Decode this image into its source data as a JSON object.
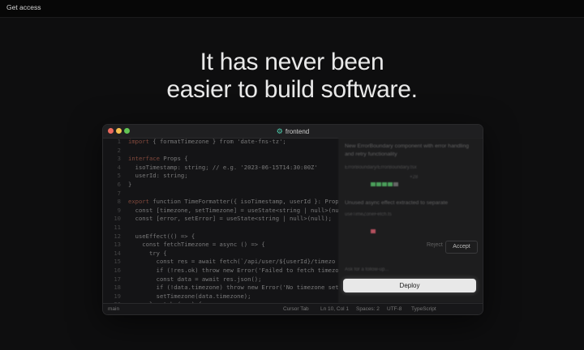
{
  "topbar": {
    "get_access": "Get access"
  },
  "hero": {
    "line1": "It has never been",
    "line2": "easier to build software."
  },
  "window": {
    "title": "frontend",
    "title_icon": "gear-icon"
  },
  "code_lines": [
    {
      "n": "1",
      "kw": "import",
      "text": " { formatTimezone } from 'date-fns-tz';"
    },
    {
      "n": "2",
      "kw": "",
      "text": ""
    },
    {
      "n": "3",
      "kw": "interface",
      "text": " Props {"
    },
    {
      "n": "4",
      "kw": "",
      "text": "  isoTimestamp: string; // e.g. '2023-06-15T14:30:00Z'"
    },
    {
      "n": "5",
      "kw": "",
      "text": "  userId: string;"
    },
    {
      "n": "6",
      "kw": "",
      "text": "}"
    },
    {
      "n": "7",
      "kw": "",
      "text": ""
    },
    {
      "n": "8",
      "kw": "export",
      "text": " function TimeFormatter({ isoTimestamp, userId }: Props"
    },
    {
      "n": "9",
      "kw": "",
      "text": "  const [timezone, setTimezone] = useState<string | null>(nu"
    },
    {
      "n": "10",
      "kw": "",
      "text": "  const [error, setError] = useState<string | null>(null);"
    },
    {
      "n": "11",
      "kw": "",
      "text": ""
    },
    {
      "n": "12",
      "kw": "",
      "text": "  useEffect(() => {"
    },
    {
      "n": "13",
      "kw": "",
      "text": "    const fetchTimezone = async () => {"
    },
    {
      "n": "14",
      "kw": "",
      "text": "      try {"
    },
    {
      "n": "15",
      "kw": "",
      "text": "        const res = await fetch(`/api/user/${userId}/timezo"
    },
    {
      "n": "16",
      "kw": "",
      "text": "        if (!res.ok) throw new Error('Failed to fetch timezo"
    },
    {
      "n": "17",
      "kw": "",
      "text": "        const data = await res.json();"
    },
    {
      "n": "18",
      "kw": "",
      "text": "        if (!data.timezone) throw new Error('No timezone set"
    },
    {
      "n": "19",
      "kw": "",
      "text": "        setTimezone(data.timezone);"
    },
    {
      "n": "20",
      "kw": "",
      "text": "      } catch (err) {"
    }
  ],
  "panel": {
    "item1_text": "New ErrorBoundary component with error handling and retry functionality",
    "item1_file": "ErrorBoundary/ErrorBoundary.tsx",
    "item1_count": "+28",
    "item2_text": "Unused async effect extracted to separate",
    "item2_file": "useTimeZoneFetch.ts",
    "follow_up": "Ask for a follow-up...",
    "reject": "Reject",
    "accept": "Accept",
    "deploy": "Deploy"
  },
  "status": {
    "branch": "main",
    "cursor": "Cursor Tab",
    "pos": "Ln 10, Col 1",
    "spaces": "Spaces: 2",
    "enc": "UTF-8",
    "lang": "TypeScript"
  }
}
